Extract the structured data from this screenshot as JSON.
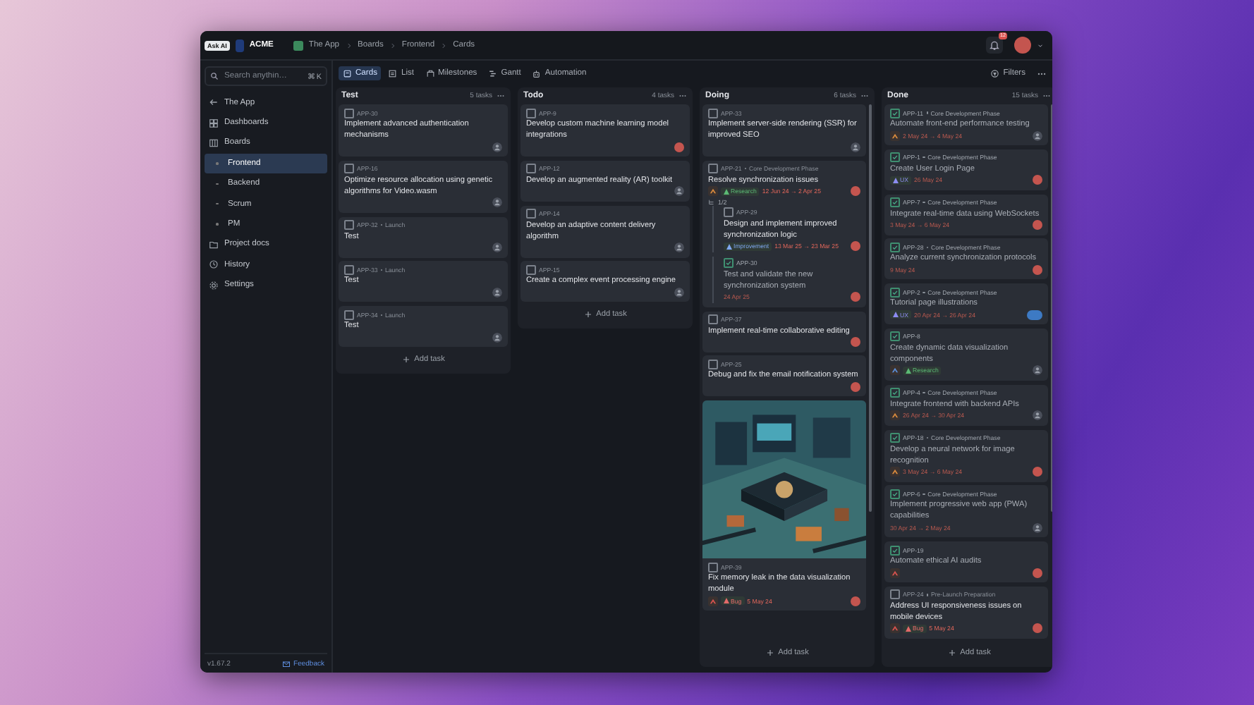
{
  "titlebar": {
    "ai_badge": "Ask AI",
    "workspace": "ACME",
    "breadcrumbs": [
      "The App",
      "Boards",
      "Frontend",
      "Cards"
    ],
    "notifications": "12"
  },
  "sidebar": {
    "search": {
      "placeholder": "Search anythin…",
      "shortcut": "⌘ K"
    },
    "items": [
      {
        "kind": "back",
        "label": "The App",
        "selected": false
      },
      {
        "kind": "dashboards",
        "label": "Dashboards",
        "selected": false
      },
      {
        "kind": "boards",
        "label": "Boards",
        "selected": false,
        "children": [
          {
            "label": "Frontend",
            "selected": true
          },
          {
            "label": "Backend",
            "selected": false
          },
          {
            "label": "Scrum",
            "selected": false
          },
          {
            "label": "PM",
            "selected": false
          }
        ]
      },
      {
        "kind": "docs",
        "label": "Project docs",
        "selected": false
      },
      {
        "kind": "history",
        "label": "History",
        "selected": false
      },
      {
        "kind": "settings",
        "label": "Settings",
        "selected": false
      }
    ],
    "version": "v1.67.2",
    "feedback": "Feedback"
  },
  "views": [
    {
      "kind": "cards",
      "label": "Cards",
      "selected": true
    },
    {
      "kind": "list",
      "label": "List",
      "selected": false
    },
    {
      "kind": "milestones",
      "label": "Milestones",
      "selected": false
    },
    {
      "kind": "gantt",
      "label": "Gantt",
      "selected": false
    },
    {
      "kind": "automation",
      "label": "Automation",
      "selected": false
    }
  ],
  "filters": "Filters",
  "columns": [
    {
      "title": "Test",
      "count": "5 tasks",
      "add": "Add task",
      "scroll": false,
      "cards": [
        {
          "id": "APP-30",
          "title": "Implement advanced authentication mechanisms",
          "done": false,
          "assigned": false
        },
        {
          "id": "APP-16",
          "title": "Optimize resource allocation using genetic algorithms for Video.wasm",
          "done": false,
          "assigned": false
        },
        {
          "id": "APP-32",
          "phase": "Launch",
          "title": "Test",
          "done": false,
          "assigned": false
        },
        {
          "id": "APP-33",
          "phase": "Launch",
          "title": "Test",
          "done": false,
          "assigned": false
        },
        {
          "id": "APP-34",
          "phase": "Launch",
          "title": "Test",
          "done": false,
          "assigned": false
        }
      ]
    },
    {
      "title": "Todo",
      "count": "4 tasks",
      "add": "Add task",
      "scroll": false,
      "cards": [
        {
          "id": "APP-9",
          "title": "Develop custom machine learning model integrations",
          "done": false,
          "assigned": true
        },
        {
          "id": "APP-12",
          "title": "Develop an augmented reality (AR) toolkit",
          "done": false,
          "assigned": false
        },
        {
          "id": "APP-14",
          "title": "Develop an adaptive content delivery algorithm",
          "done": false,
          "assigned": false
        },
        {
          "id": "APP-15",
          "title": "Create a complex event processing engine",
          "done": false,
          "assigned": false
        }
      ]
    },
    {
      "title": "Doing",
      "count": "6 tasks",
      "add": "Add task",
      "scroll": true,
      "cards": [
        {
          "id": "APP-33",
          "title": "Implement server-side rendering (SSR) for improved SEO",
          "done": false,
          "assigned": false
        },
        {
          "id": "APP-21",
          "phase": "Core Development Phase",
          "title": "Resolve synchronization issues",
          "done": false,
          "priority": {
            "color": "#d98a3d"
          },
          "label": {
            "text": "Research",
            "color": "#5bb974"
          },
          "dates": "12 Jun 24 → 2 Apr 25",
          "assigned": true,
          "subtasks": {
            "count": "1/2",
            "items": [
              {
                "id": "APP-29",
                "title": "Design and implement improved synchronization logic",
                "done": false,
                "label": {
                  "text": "Improvement",
                  "color": "#7fa8f0"
                },
                "dates": "13 Mar 25 → 23 Mar 25",
                "assigned": true
              },
              {
                "id": "APP-30",
                "title": "Test and validate the new synchronization system",
                "done": true,
                "dates": "24 Apr 25",
                "assigned": true
              }
            ]
          }
        },
        {
          "id": "APP-37",
          "title": "Implement real-time collaborative editing",
          "done": false,
          "assigned": true
        },
        {
          "id": "APP-25",
          "title": "Debug and fix the email notification system",
          "done": false,
          "assigned": true
        },
        {
          "id": "APP-39",
          "title": "Fix memory leak in the data visualization module",
          "done": false,
          "priority": {
            "color": "#d9534f"
          },
          "label": {
            "text": "Bug",
            "color": "#e26a6a"
          },
          "dates": "5 May 24",
          "assigned": true
        }
      ]
    },
    {
      "title": "Done",
      "count": "15 tasks",
      "add": "Add task",
      "scroll": true,
      "cards": [
        {
          "id": "APP-11",
          "phase": "Core Development Phase",
          "title": "Automate front-end performance testing",
          "done": true,
          "priority": {
            "color": "#d98a3d"
          },
          "dates": "2 May 24 → 4 May 24",
          "assigned": false
        },
        {
          "id": "APP-1",
          "phase": "Core Development Phase",
          "title": "Create User Login Page",
          "done": true,
          "label": {
            "text": "UX",
            "color": "#8c8cf0"
          },
          "dates": "26 May 24",
          "assigned": true
        },
        {
          "id": "APP-7",
          "phase": "Core Development Phase",
          "title": "Integrate real-time data using WebSockets",
          "done": true,
          "dates": "3 May 24 → 6 May 24",
          "assigned": true
        },
        {
          "id": "APP-28",
          "phase": "Core Development Phase",
          "title": "Analyze current synchronization protocols",
          "done": true,
          "dates": "9 May 24",
          "assigned": true
        },
        {
          "id": "APP-2",
          "phase": "Core Development Phase",
          "title": "Tutorial page illustrations",
          "done": true,
          "label": {
            "text": "UX",
            "color": "#8c8cf0"
          },
          "dates": "20 Apr 24 → 26 Apr 24",
          "assigned": true,
          "shared": true
        },
        {
          "id": "APP-8",
          "title": "Create dynamic data visualization components",
          "done": true,
          "priority": {
            "color": "#5b8fd9"
          },
          "label": {
            "text": "Research",
            "color": "#5bb974"
          },
          "assigned": false
        },
        {
          "id": "APP-4",
          "phase": "Core Development Phase",
          "title": "Integrate frontend with backend APIs",
          "done": true,
          "priority": {
            "color": "#d98a3d"
          },
          "dates": "26 Apr 24 → 30 Apr 24",
          "assigned": false
        },
        {
          "id": "APP-18",
          "phase": "Core Development Phase",
          "title": "Develop a neural network for image recognition",
          "done": true,
          "priority": {
            "color": "#d98a3d"
          },
          "dates": "3 May 24 → 6 May 24",
          "assigned": true
        },
        {
          "id": "APP-6",
          "phase": "Core Development Phase",
          "title": "Implement progressive web app (PWA) capabilities",
          "done": true,
          "dates": "30 Apr 24 → 2 May 24",
          "assigned": false
        },
        {
          "id": "APP-19",
          "title": "Automate ethical AI audits",
          "done": true,
          "priority": {
            "color": "#d9534f"
          },
          "assigned": true
        },
        {
          "id": "APP-24",
          "phase": "Pre-Launch Preparation",
          "title": "Address UI responsiveness issues on mobile devices",
          "done": false,
          "priority": {
            "color": "#d9534f"
          },
          "label": {
            "text": "Bug",
            "color": "#e26a6a"
          },
          "dates": "5 May 24",
          "assigned": true
        }
      ]
    }
  ]
}
